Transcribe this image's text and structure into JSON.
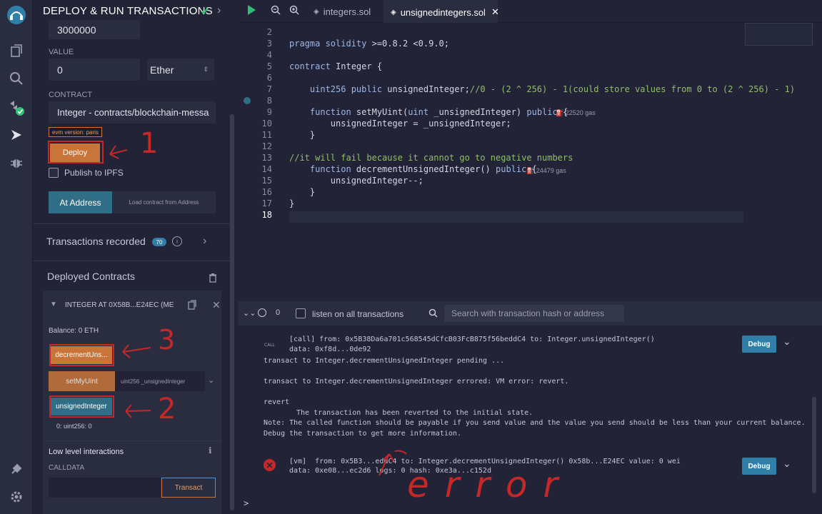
{
  "sidebar_icons": [
    "remix-logo-icon",
    "file-explorer-icon",
    "search-icon",
    "compiler-icon",
    "deploy-run-icon",
    "debugger-icon",
    "plugin-manager-icon",
    "settings-icon"
  ],
  "panel": {
    "title": "DEPLOY & RUN TRANSACTIONS",
    "gas_limit_value": "3000000",
    "value_label": "VALUE",
    "value_amount": "0",
    "value_unit": "Ether",
    "contract_label": "CONTRACT",
    "contract_select": "Integer - contracts/blockchain-messa",
    "evm_badge": "evm version: paris",
    "deploy_label": "Deploy",
    "publish_label": "Publish to IPFS",
    "at_address_label": "At Address",
    "load_contract_label": "Load contract from Address",
    "transactions_recorded_label": "Transactions recorded",
    "transactions_count": "70",
    "deployed_contracts_label": "Deployed Contracts",
    "instance_title": "INTEGER AT 0X58B...E24EC (MEM",
    "balance": "Balance: 0 ETH",
    "fn_decrement": "decrementUns...",
    "fn_set": "setMyUint",
    "fn_set_placeholder": "uint256 _unsignedInteger",
    "fn_unsigned": "unsignedInteger",
    "unsigned_result": "0: uint256: 0",
    "low_level_label": "Low level interactions",
    "calldata_label": "CALLDATA",
    "transact_label": "Transact"
  },
  "annotations": {
    "one": "1",
    "two": "2",
    "three": "3",
    "error_text": "error"
  },
  "tabs": [
    {
      "label": "integers.sol",
      "active": false
    },
    {
      "label": "unsignedintegers.sol",
      "active": true
    }
  ],
  "editor": {
    "line_numbers": [
      "2",
      "3",
      "4",
      "5",
      "6",
      "7",
      "8",
      "9",
      "10",
      "11",
      "12",
      "13",
      "14",
      "15",
      "16",
      "17",
      "18"
    ],
    "gas1": "22520 gas",
    "gas2": "24479 gas"
  },
  "terminal": {
    "count": "0",
    "listen_label": "listen on all transactions",
    "search_placeholder": "Search with transaction hash or address",
    "call_badge": "CALL",
    "call_line1": "[call] from: 0x5B38Da6a701c568545dCfcB03FcB875f56beddC4 to: Integer.unsignedInteger()",
    "call_line2": "data: 0xf8d...0de92",
    "pending": "transact to Integer.decrementUnsignedInteger pending ...",
    "errored": "transact to Integer.decrementUnsignedInteger errored: VM error: revert.",
    "revert": "revert",
    "revert_msg": "The transaction has been reverted to the initial state.",
    "note": "Note: The called function should be payable if you send value and the value you send should be less than your current balance.",
    "debug_msg": "Debug the transaction to get more information.",
    "vm_line1": "[vm]  from: 0x5B3...eddC4 to: Integer.decrementUnsignedInteger() 0x58b...E24EC value: 0 wei",
    "vm_line2": "data: 0xe08...ec2d6 logs: 0 hash: 0xe3a...c152d",
    "debug_label": "Debug",
    "prompt": ">"
  },
  "colors": {
    "accent_orange": "#c97539",
    "accent_blue": "#2f6e86",
    "error_red": "#c62828",
    "check_green": "#2fbf71"
  }
}
